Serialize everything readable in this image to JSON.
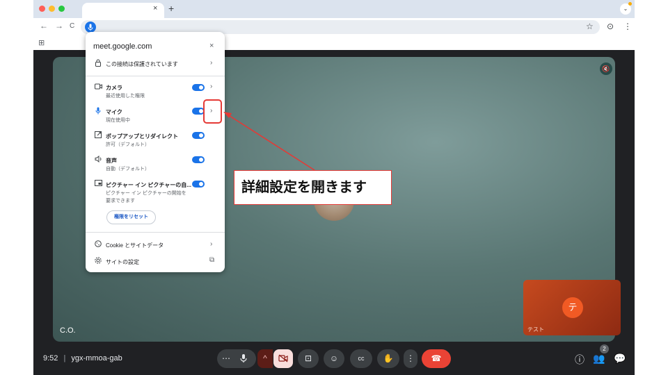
{
  "browser": {
    "tab_close": "×",
    "new_tab": "+",
    "tab_menu": "⌄",
    "back": "←",
    "forward": "→",
    "reload": "C",
    "bookmark_star": "☆",
    "profile": "⊙",
    "menu": "⋮",
    "apps": "⊞",
    "colors": {
      "tabstrip": "#dbe3ee",
      "accent": "#1a73e8"
    }
  },
  "popup": {
    "host": "meet.google.com",
    "close": "×",
    "connection": {
      "label": "この接続は保護されています",
      "icon": "lock-icon"
    },
    "permissions": [
      {
        "name": "camera",
        "icon": "camera-icon",
        "title": "カメラ",
        "subtitle": "最近使用した権限",
        "toggle": true,
        "chevron": true
      },
      {
        "name": "mic",
        "icon": "mic-icon",
        "title": "マイク",
        "subtitle": "現在使用中",
        "toggle": true,
        "chevron": true
      },
      {
        "name": "popup",
        "icon": "popup-icon",
        "title": "ポップアップとリダイレクト",
        "subtitle": "許可（デフォルト）",
        "toggle": true,
        "chevron": false
      },
      {
        "name": "sound",
        "icon": "speaker-icon",
        "title": "音声",
        "subtitle": "自動（デフォルト）",
        "toggle": true,
        "chevron": false
      },
      {
        "name": "pip",
        "icon": "pip-icon",
        "title": "ピクチャー イン ピクチャーの自...",
        "subtitle": "ピクチャー イン ピクチャーの開始を",
        "subtitle2": "要求できます",
        "toggle": true,
        "chevron": false
      }
    ],
    "reset_button": "権限をリセット",
    "cookie": {
      "label": "Cookie とサイトデータ",
      "icon": "cookie-icon"
    },
    "site_settings": {
      "label": "サイトの設定",
      "icon": "gear-icon"
    },
    "chevron": "›",
    "external": "⧉"
  },
  "annotation": {
    "callout_text": "詳細設定を開きます",
    "color": "#e53935"
  },
  "meet": {
    "participant_name": "C.O.",
    "self_name": "テスト",
    "self_initial": "テ",
    "meeting_time": "9:52",
    "separator": "|",
    "meeting_code": "ygx-mmoa-gab",
    "participants_count": "2",
    "controls": {
      "more": "⋯",
      "mic": "🎙",
      "caret": "^",
      "camera_off": "⊘",
      "present": "⊡",
      "emoji": "☺",
      "captions": "cc",
      "raise_hand": "✋",
      "more_options": "⋮",
      "hangup": "☎"
    },
    "right_icons": {
      "info": "ⓘ",
      "people": "👥",
      "chat": "💬"
    },
    "mute": "🔇"
  }
}
